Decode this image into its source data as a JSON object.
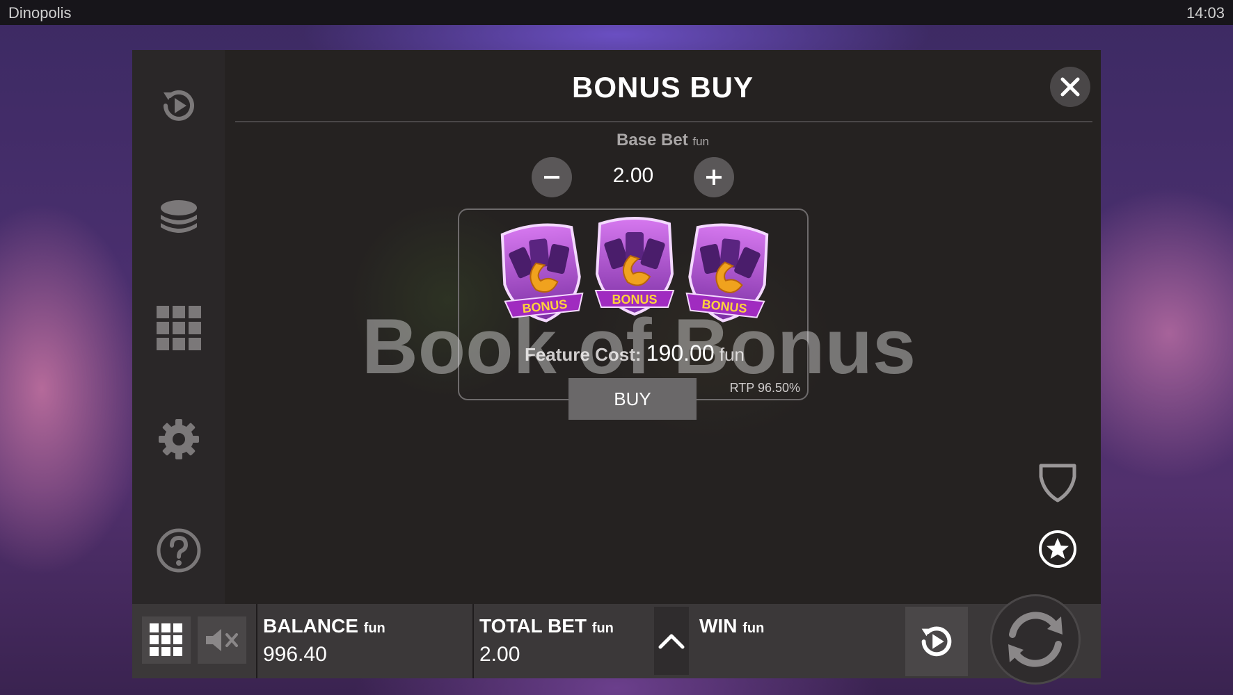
{
  "system_bar": {
    "app_title": "Dinopolis",
    "clock": "14:03"
  },
  "side_menu": {
    "items": [
      {
        "icon": "autoplay-icon"
      },
      {
        "icon": "coin-stack-icon"
      },
      {
        "icon": "bonus-grid-icon"
      },
      {
        "icon": "gear-icon"
      },
      {
        "icon": "help-icon"
      }
    ]
  },
  "dialog": {
    "title": "BONUS BUY",
    "base_bet_label": "Base Bet",
    "base_bet_unit": "fun",
    "base_bet_value": "2.00",
    "bonus_symbol_text": "BONUS",
    "feature_cost_label": "Feature Cost:",
    "feature_cost_value": "190.00",
    "feature_cost_unit": "fun",
    "rtp": "RTP 96.50%",
    "buy_label": "BUY",
    "watermark": "Book of Bonus"
  },
  "bottom_bar": {
    "balance_label": "BALANCE",
    "balance_unit": "fun",
    "balance_value": "996.40",
    "total_bet_label": "TOTAL BET",
    "total_bet_unit": "fun",
    "total_bet_value": "2.00",
    "win_label": "WIN",
    "win_unit": "fun"
  },
  "colors": {
    "frame_bg": "#1f1c1d",
    "side_menu_bg": "#2a2728",
    "bottom_bar_bg": "#3b3839",
    "button_grey": "#5a5758",
    "bonus_purple": "#a64fc4",
    "bonus_gold": "#f0a21e"
  }
}
